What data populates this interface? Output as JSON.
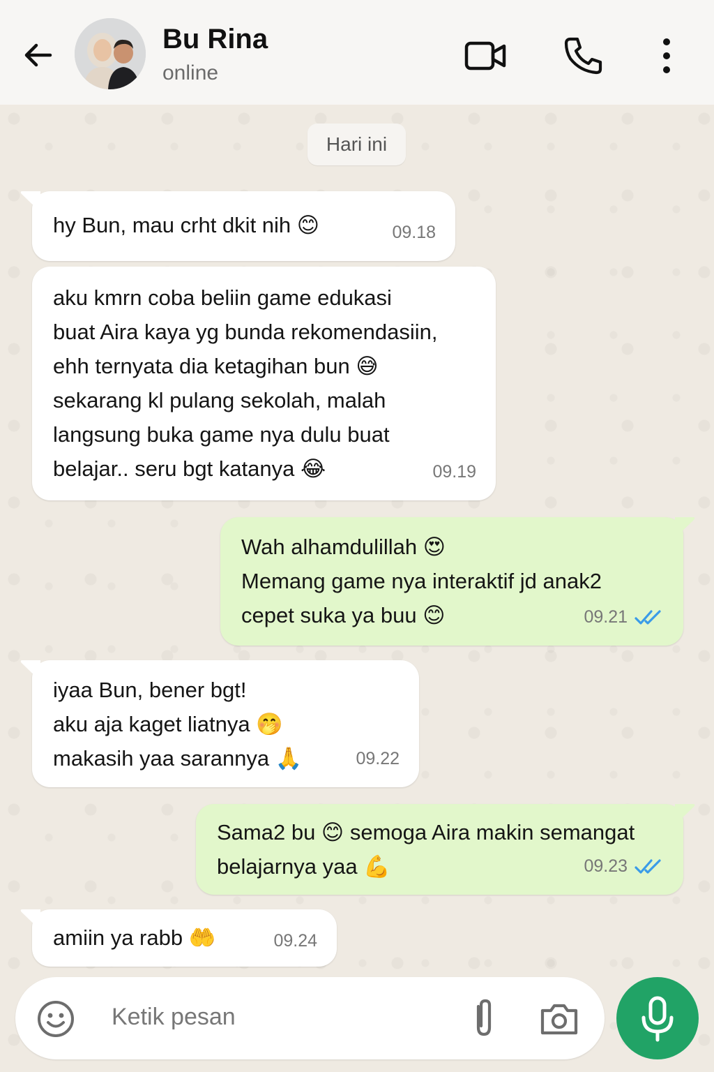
{
  "header": {
    "name": "Bu Rina",
    "status": "online"
  },
  "date_chip": "Hari ini",
  "messages": [
    {
      "dir": "in",
      "text": "hy Bun, mau crht dkit nih 😊",
      "time": "09.18"
    },
    {
      "dir": "in",
      "text": "aku kmrn coba beliin game edukasi\nbuat Aira kaya yg bunda rekomendasiin,\nehh ternyata dia ketagihan bun 😅\nsekarang kl pulang sekolah, malah\nlangsung buka game nya dulu buat\nbelajar.. seru bgt katanya 😂",
      "time": "09.19"
    },
    {
      "dir": "out",
      "text": "Wah alhamdulillah 😍\nMemang game nya interaktif jd anak2\ncepet suka ya buu 😊",
      "time": "09.21",
      "read": true
    },
    {
      "dir": "in",
      "text": "iyaa Bun, bener bgt!\naku aja kaget liatnya 🤭\nmakasih yaa sarannya 🙏",
      "time": "09.22"
    },
    {
      "dir": "out",
      "text": "Sama2 bu 😊 semoga Aira makin semangat\nbelajarnya yaa 💪",
      "time": "09.23",
      "read": true
    },
    {
      "dir": "in",
      "text": "amiin ya rabb 🤲",
      "time": "09.24"
    }
  ],
  "input": {
    "placeholder": "Ketik pesan"
  },
  "colors": {
    "incoming": "#ffffff",
    "outgoing": "#e2f7cb",
    "read_ticks": "#3a9be8",
    "mic_button": "#21a366"
  },
  "icons": [
    "back-arrow-icon",
    "video-call-icon",
    "phone-icon",
    "more-vert-icon",
    "emoji-icon",
    "attach-icon",
    "camera-icon",
    "mic-icon",
    "double-check-icon"
  ]
}
